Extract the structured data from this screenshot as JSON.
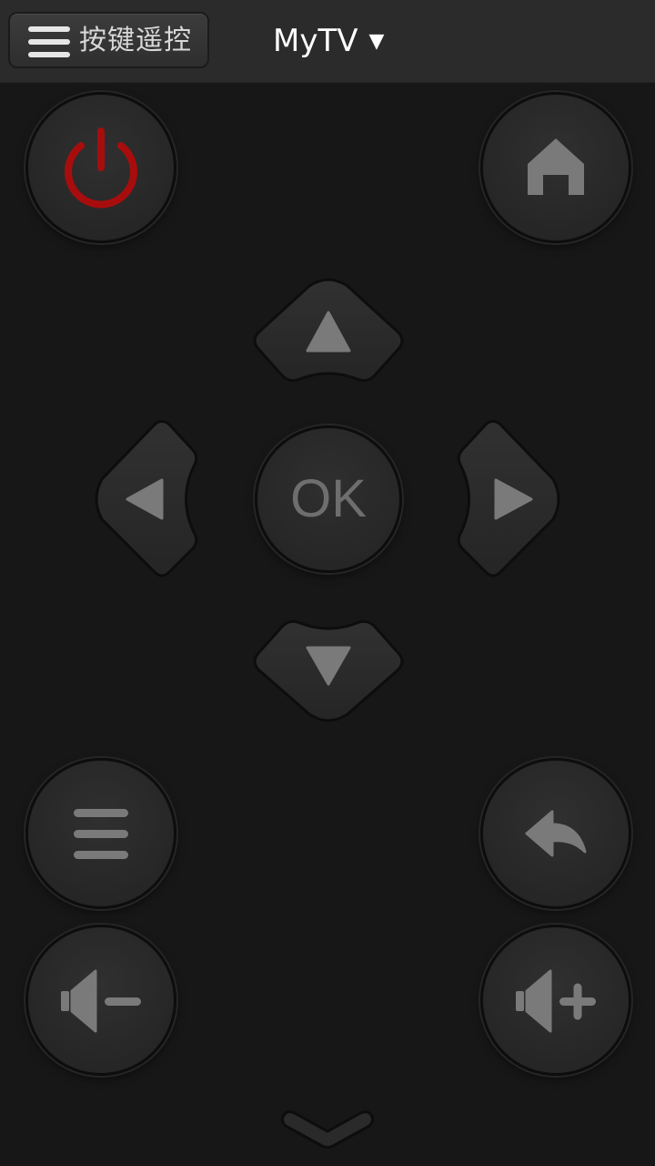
{
  "header": {
    "mode_label": "按键遥控",
    "device_name": "MyTV",
    "device_caret": "▼"
  },
  "dpad": {
    "ok_label": "OK"
  },
  "icons": {
    "menu": "hamburger-icon",
    "power": "power-icon",
    "home": "home-icon",
    "up": "triangle-up-icon",
    "down": "triangle-down-icon",
    "left": "triangle-left-icon",
    "right": "triangle-right-icon",
    "options": "hamburger-icon",
    "back": "back-arrow-icon",
    "volume_down": "speaker-minus-icon",
    "volume_up": "speaker-plus-icon",
    "more": "chevron-down-icon"
  },
  "colors": {
    "background": "#171717",
    "header": "#2b2b2b",
    "button": "#262626",
    "icon": "#7a7a7a",
    "power_accent": "#a80d0d"
  }
}
